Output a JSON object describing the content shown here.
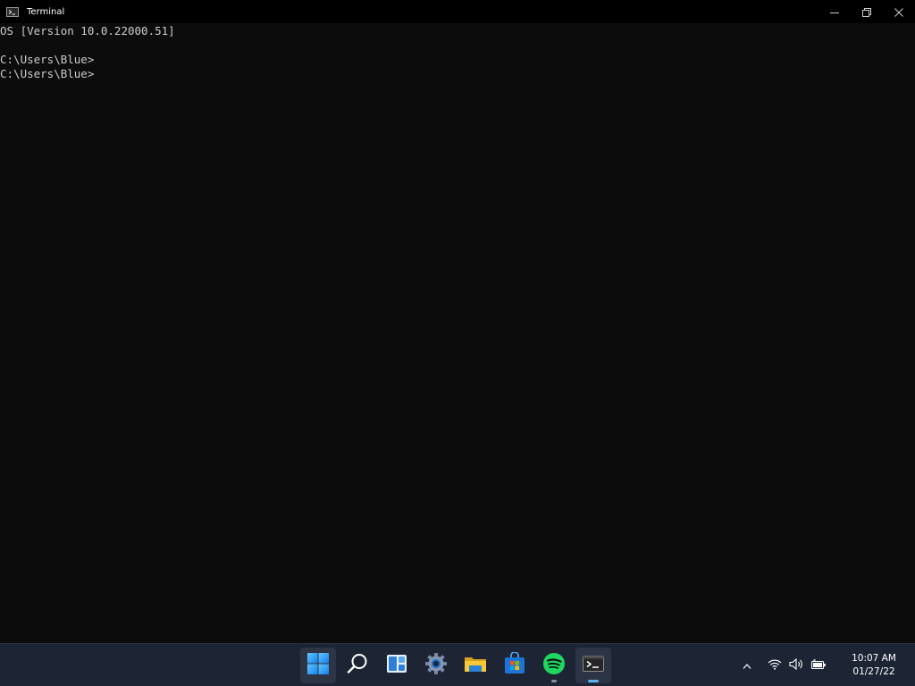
{
  "window": {
    "title": "Terminal",
    "icon": "terminal-icon",
    "controls": [
      "minimize-icon",
      "restore-icon",
      "close-icon"
    ]
  },
  "console": {
    "lines": [
      "OS [Version 10.0.22000.51]",
      "",
      "C:\\Users\\Blue>",
      "C:\\Users\\Blue>"
    ],
    "text_color": "#cccccc",
    "background": "#0c0c0c"
  },
  "taskbar": {
    "background": "#1d2535",
    "apps": [
      {
        "name": "start",
        "icon": "windows-start-icon"
      },
      {
        "name": "search",
        "icon": "search-icon"
      },
      {
        "name": "widgets",
        "icon": "widgets-icon"
      },
      {
        "name": "settings",
        "icon": "gear-icon"
      },
      {
        "name": "file-explorer",
        "icon": "folder-icon"
      },
      {
        "name": "microsoft-store",
        "icon": "store-icon"
      },
      {
        "name": "spotify",
        "icon": "spotify-icon",
        "running": true
      },
      {
        "name": "terminal",
        "icon": "terminal-icon",
        "running": true,
        "focused": true
      }
    ],
    "tray": {
      "icons": [
        "chevron-up-icon",
        "wifi-icon",
        "volume-icon",
        "battery-icon"
      ],
      "time": "10:07 AM",
      "date": "01/27/22"
    }
  }
}
